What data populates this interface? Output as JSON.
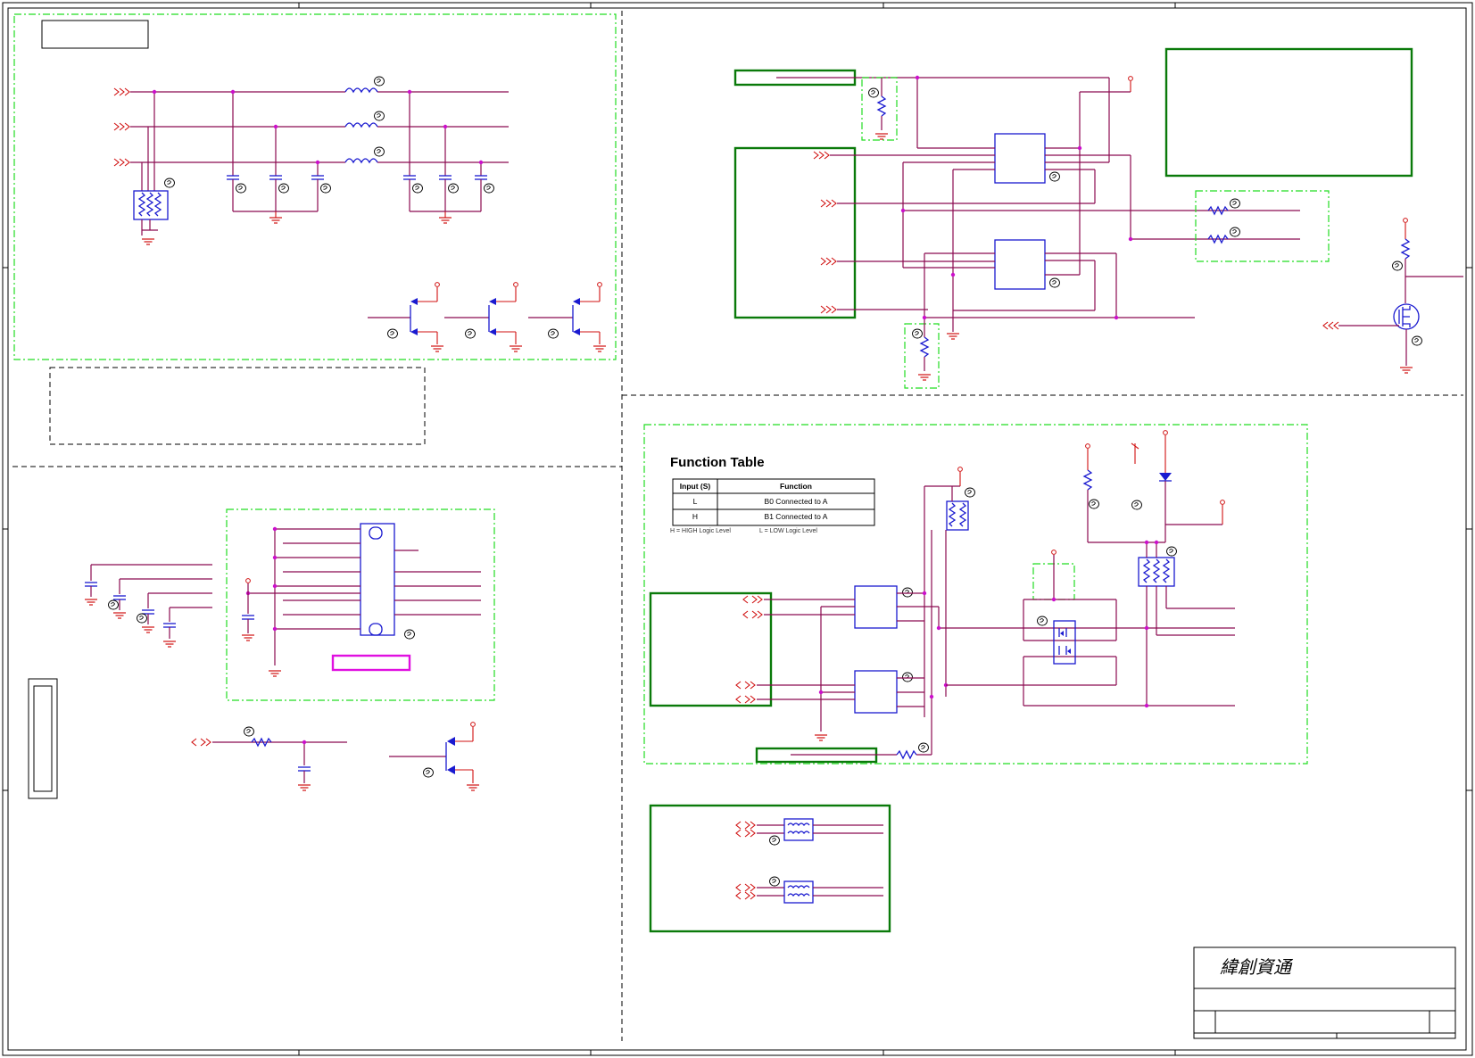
{
  "function_table": {
    "title": "Function Table",
    "headers": [
      "Input (S)",
      "Function"
    ],
    "rows": [
      [
        "L",
        "B0 Connected to A"
      ],
      [
        "H",
        "B1 Connected to A"
      ]
    ],
    "footnote_high": "H = HIGH Logic Level",
    "footnote_low": "L = LOW Logic Level"
  },
  "title_block": {
    "company_logo_text": "緯創資通"
  },
  "colors": {
    "net": "#8b0a50",
    "power": "#d01010",
    "component": "#1a1ad0",
    "group_box": "#0a7a0a",
    "dash_region": "#22dd22",
    "junction": "#cc10cc"
  }
}
